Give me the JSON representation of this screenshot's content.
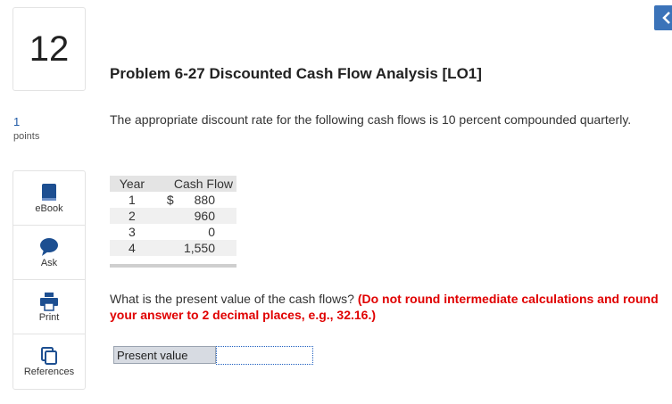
{
  "question": {
    "number": "12",
    "points_value": "1",
    "points_label": "points"
  },
  "tools": [
    {
      "label": "eBook",
      "icon": "book-icon"
    },
    {
      "label": "Ask",
      "icon": "chat-bubble-icon"
    },
    {
      "label": "Print",
      "icon": "printer-icon"
    },
    {
      "label": "References",
      "icon": "copy-icon"
    }
  ],
  "colors": {
    "accent_blue": "#3b73b9",
    "red_instruction": "#e00000"
  },
  "problem": {
    "title": "Problem 6-27 Discounted Cash Flow Analysis [LO1]",
    "intro": "The appropriate discount rate for the following cash flows is 10 percent compounded quarterly.",
    "table": {
      "headers": {
        "year": "Year",
        "flow": "Cash Flow"
      },
      "rows": [
        {
          "year": "1",
          "currency": "$",
          "flow": "880"
        },
        {
          "year": "2",
          "currency": "",
          "flow": "960"
        },
        {
          "year": "3",
          "currency": "",
          "flow": "0"
        },
        {
          "year": "4",
          "currency": "",
          "flow": "1,550"
        }
      ]
    },
    "question_text": "What is the present value of the cash flows?",
    "instruction": "(Do not round intermediate calculations and round your answer to 2 decimal places, e.g., 32.16.)",
    "answer": {
      "label": "Present value",
      "value": "",
      "placeholder": ""
    }
  }
}
